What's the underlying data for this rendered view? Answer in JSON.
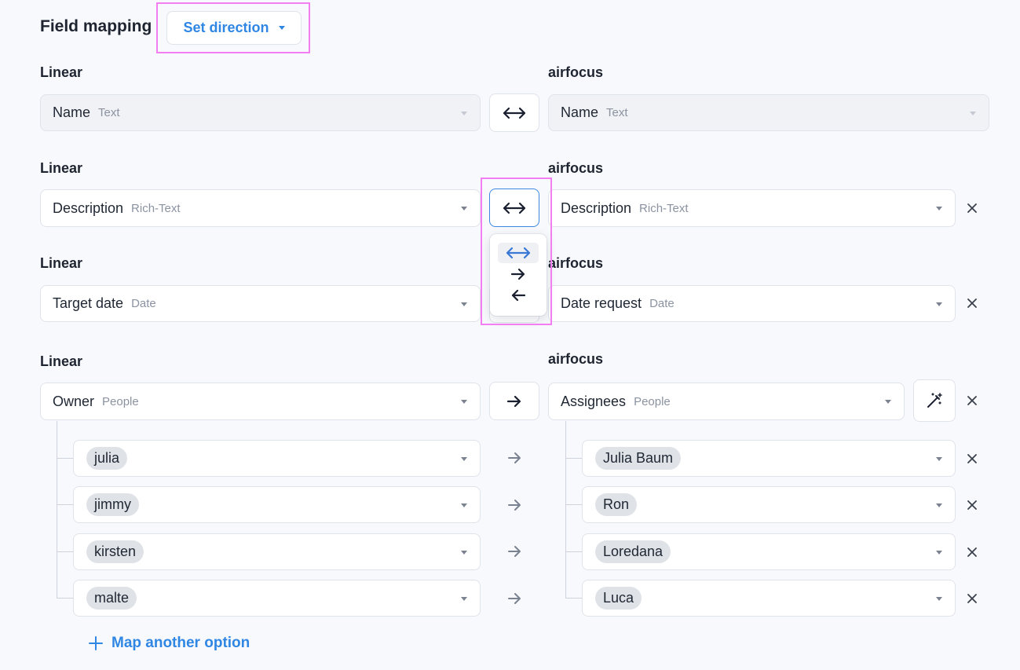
{
  "header": {
    "title": "Field mapping",
    "set_direction_label": "Set direction"
  },
  "mappings": [
    {
      "left_label": "Linear",
      "right_label": "airfocus",
      "left_field": "Name",
      "left_type": "Text",
      "right_field": "Name",
      "right_type": "Text",
      "direction": "both"
    },
    {
      "left_label": "Linear",
      "right_label": "airfocus",
      "left_field": "Description",
      "left_type": "Rich-Text",
      "right_field": "Description",
      "right_type": "Rich-Text",
      "direction": "both"
    },
    {
      "left_label": "Linear",
      "right_label": "airfocus",
      "left_field": "Target date",
      "left_type": "Date",
      "right_field": "Date request",
      "right_type": "Date",
      "direction": "both"
    },
    {
      "left_label": "Linear",
      "right_label": "airfocus",
      "left_field": "Owner",
      "left_type": "People",
      "right_field": "Assignees",
      "right_type": "People",
      "direction": "right",
      "options": [
        {
          "left": "julia",
          "right": "Julia Baum"
        },
        {
          "left": "jimmy",
          "right": "Ron"
        },
        {
          "left": "kirsten",
          "right": "Loredana"
        },
        {
          "left": "malte",
          "right": "Luca"
        }
      ]
    }
  ],
  "direction_menu": {
    "options": [
      "both",
      "right",
      "left"
    ],
    "selected": "both"
  },
  "map_another_label": "Map another option",
  "colors": {
    "accent": "#2f86e3",
    "highlight": "#f27ef1"
  }
}
